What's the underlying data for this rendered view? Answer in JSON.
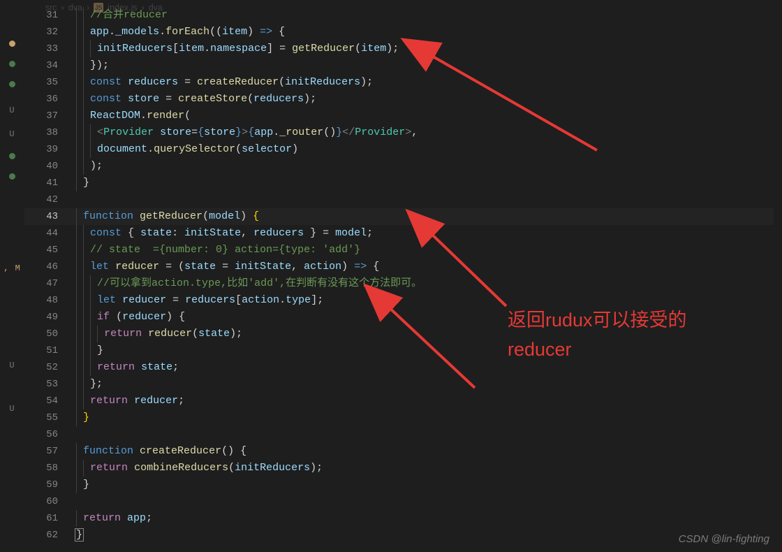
{
  "breadcrumb": {
    "seg1": "src",
    "seg2": "dva",
    "file": "index.js",
    "tail": "dva"
  },
  "rail": {
    "dots": [
      "#c9a26d",
      "#4b7a4b",
      "#4b7a4b"
    ],
    "marks": [
      "U",
      "U",
      "",
      ", M",
      "",
      "",
      "U",
      "",
      "U"
    ],
    "dots2": [
      "#4b7a4b",
      "#4b7a4b"
    ]
  },
  "lines": {
    "31": {
      "i": 2,
      "tokens": [
        [
          "c-comment",
          "//合并reducer"
        ]
      ]
    },
    "32": {
      "i": 2,
      "tokens": [
        [
          "c-var",
          "app"
        ],
        [
          "c-punct",
          "."
        ],
        [
          "c-var",
          "_models"
        ],
        [
          "c-punct",
          "."
        ],
        [
          "c-func",
          "forEach"
        ],
        [
          "c-punct",
          "(("
        ],
        [
          "c-var",
          "item"
        ],
        [
          "c-punct",
          ") "
        ],
        [
          "c-keyword",
          "=>"
        ],
        [
          "c-punct",
          " {"
        ]
      ]
    },
    "33": {
      "i": 3,
      "tokens": [
        [
          "c-var",
          "initReducers"
        ],
        [
          "c-punct",
          "["
        ],
        [
          "c-var",
          "item"
        ],
        [
          "c-punct",
          "."
        ],
        [
          "c-var",
          "namespace"
        ],
        [
          "c-punct",
          "] = "
        ],
        [
          "c-func",
          "getReducer"
        ],
        [
          "c-punct",
          "("
        ],
        [
          "c-var",
          "item"
        ],
        [
          "c-punct",
          ");"
        ]
      ]
    },
    "34": {
      "i": 2,
      "tokens": [
        [
          "c-punct",
          "});"
        ]
      ]
    },
    "35": {
      "i": 2,
      "tokens": [
        [
          "c-keyword",
          "const"
        ],
        [
          "c-punct",
          " "
        ],
        [
          "c-var",
          "reducers"
        ],
        [
          "c-punct",
          " = "
        ],
        [
          "c-func",
          "createReducer"
        ],
        [
          "c-punct",
          "("
        ],
        [
          "c-var",
          "initReducers"
        ],
        [
          "c-punct",
          ");"
        ]
      ]
    },
    "36": {
      "i": 2,
      "tokens": [
        [
          "c-keyword",
          "const"
        ],
        [
          "c-punct",
          " "
        ],
        [
          "c-var",
          "store"
        ],
        [
          "c-punct",
          " = "
        ],
        [
          "c-func",
          "createStore"
        ],
        [
          "c-punct",
          "("
        ],
        [
          "c-var",
          "reducers"
        ],
        [
          "c-punct",
          ");"
        ]
      ]
    },
    "37": {
      "i": 2,
      "tokens": [
        [
          "c-var",
          "ReactDOM"
        ],
        [
          "c-punct",
          "."
        ],
        [
          "c-func",
          "render"
        ],
        [
          "c-punct",
          "("
        ]
      ]
    },
    "38": {
      "i": 3,
      "tokens": [
        [
          "c-jsx",
          "<"
        ],
        [
          "c-type",
          "Provider"
        ],
        [
          "c-punct",
          " "
        ],
        [
          "c-var",
          "store"
        ],
        [
          "c-punct",
          "="
        ],
        [
          "c-keyword",
          "{"
        ],
        [
          "c-var",
          "store"
        ],
        [
          "c-keyword",
          "}"
        ],
        [
          "c-jsx",
          ">"
        ],
        [
          "c-keyword",
          "{"
        ],
        [
          "c-var",
          "app"
        ],
        [
          "c-punct",
          "."
        ],
        [
          "c-func",
          "_router"
        ],
        [
          "c-punct",
          "()"
        ],
        [
          "c-keyword",
          "}"
        ],
        [
          "c-jsx",
          "</"
        ],
        [
          "c-type",
          "Provider"
        ],
        [
          "c-jsx",
          ">"
        ],
        [
          "c-punct",
          ","
        ]
      ]
    },
    "39": {
      "i": 3,
      "tokens": [
        [
          "c-var",
          "document"
        ],
        [
          "c-punct",
          "."
        ],
        [
          "c-func",
          "querySelector"
        ],
        [
          "c-punct",
          "("
        ],
        [
          "c-var",
          "selector"
        ],
        [
          "c-punct",
          ")"
        ]
      ]
    },
    "40": {
      "i": 2,
      "tokens": [
        [
          "c-punct",
          ");"
        ]
      ]
    },
    "41": {
      "i": 1,
      "tokens": [
        [
          "c-punct",
          "}"
        ]
      ]
    },
    "42": {
      "i": 0,
      "tokens": []
    },
    "43": {
      "i": 1,
      "tokens": [
        [
          "c-keyword",
          "function"
        ],
        [
          "c-punct",
          " "
        ],
        [
          "c-func",
          "getReducer"
        ],
        [
          "c-punct",
          "("
        ],
        [
          "c-var",
          "model"
        ],
        [
          "c-punct",
          ") "
        ],
        [
          "bracket-y",
          "{"
        ]
      ]
    },
    "44": {
      "i": 2,
      "tokens": [
        [
          "c-keyword",
          "const"
        ],
        [
          "c-punct",
          " { "
        ],
        [
          "c-var",
          "state"
        ],
        [
          "c-punct",
          ": "
        ],
        [
          "c-var",
          "initState"
        ],
        [
          "c-punct",
          ", "
        ],
        [
          "c-var",
          "reducers"
        ],
        [
          "c-punct",
          " } = "
        ],
        [
          "c-var",
          "model"
        ],
        [
          "c-punct",
          ";"
        ]
      ]
    },
    "45": {
      "i": 2,
      "tokens": [
        [
          "c-comment",
          "// state  ={number: 0} action={type: 'add'}"
        ]
      ]
    },
    "46": {
      "i": 2,
      "tokens": [
        [
          "c-keyword",
          "let"
        ],
        [
          "c-punct",
          " "
        ],
        [
          "c-func",
          "reducer"
        ],
        [
          "c-punct",
          " = ("
        ],
        [
          "c-var",
          "state"
        ],
        [
          "c-punct",
          " = "
        ],
        [
          "c-var",
          "initState"
        ],
        [
          "c-punct",
          ", "
        ],
        [
          "c-var",
          "action"
        ],
        [
          "c-punct",
          ") "
        ],
        [
          "c-keyword",
          "=>"
        ],
        [
          "c-punct",
          " {"
        ]
      ]
    },
    "47": {
      "i": 3,
      "tokens": [
        [
          "c-comment",
          "//可以拿到action.type,比如'add',在判断有没有这个方法即可。"
        ]
      ]
    },
    "48": {
      "i": 3,
      "tokens": [
        [
          "c-keyword",
          "let"
        ],
        [
          "c-punct",
          " "
        ],
        [
          "c-var",
          "reducer"
        ],
        [
          "c-punct",
          " = "
        ],
        [
          "c-var",
          "reducers"
        ],
        [
          "c-punct",
          "["
        ],
        [
          "c-var",
          "action"
        ],
        [
          "c-punct",
          "."
        ],
        [
          "c-var",
          "type"
        ],
        [
          "c-punct",
          "];"
        ]
      ]
    },
    "49": {
      "i": 3,
      "tokens": [
        [
          "c-purple",
          "if"
        ],
        [
          "c-punct",
          " ("
        ],
        [
          "c-var",
          "reducer"
        ],
        [
          "c-punct",
          ") {"
        ]
      ]
    },
    "50": {
      "i": 4,
      "tokens": [
        [
          "c-purple",
          "return"
        ],
        [
          "c-punct",
          " "
        ],
        [
          "c-func",
          "reducer"
        ],
        [
          "c-punct",
          "("
        ],
        [
          "c-var",
          "state"
        ],
        [
          "c-punct",
          ");"
        ]
      ]
    },
    "51": {
      "i": 3,
      "tokens": [
        [
          "c-punct",
          "}"
        ]
      ]
    },
    "52": {
      "i": 3,
      "tokens": [
        [
          "c-purple",
          "return"
        ],
        [
          "c-punct",
          " "
        ],
        [
          "c-var",
          "state"
        ],
        [
          "c-punct",
          ";"
        ]
      ]
    },
    "53": {
      "i": 2,
      "tokens": [
        [
          "c-punct",
          "};"
        ]
      ]
    },
    "54": {
      "i": 2,
      "tokens": [
        [
          "c-purple",
          "return"
        ],
        [
          "c-punct",
          " "
        ],
        [
          "c-var",
          "reducer"
        ],
        [
          "c-punct",
          ";"
        ]
      ]
    },
    "55": {
      "i": 1,
      "tokens": [
        [
          "bracket-y",
          "}"
        ]
      ]
    },
    "56": {
      "i": 0,
      "tokens": []
    },
    "57": {
      "i": 1,
      "tokens": [
        [
          "c-keyword",
          "function"
        ],
        [
          "c-punct",
          " "
        ],
        [
          "c-func",
          "createReducer"
        ],
        [
          "c-punct",
          "() {"
        ]
      ]
    },
    "58": {
      "i": 2,
      "tokens": [
        [
          "c-purple",
          "return"
        ],
        [
          "c-punct",
          " "
        ],
        [
          "c-func",
          "combineReducers"
        ],
        [
          "c-punct",
          "("
        ],
        [
          "c-var",
          "initReducers"
        ],
        [
          "c-punct",
          ");"
        ]
      ]
    },
    "59": {
      "i": 1,
      "tokens": [
        [
          "c-punct",
          "}"
        ]
      ]
    },
    "60": {
      "i": 0,
      "tokens": []
    },
    "61": {
      "i": 1,
      "tokens": [
        [
          "c-purple",
          "return"
        ],
        [
          "c-punct",
          " "
        ],
        [
          "c-var",
          "app"
        ],
        [
          "c-punct",
          ";"
        ]
      ]
    },
    "62": {
      "i": 0,
      "tokens": [
        [
          "sel-bracket",
          "}"
        ]
      ]
    }
  },
  "lineOrder": [
    "31",
    "32",
    "33",
    "34",
    "35",
    "36",
    "37",
    "38",
    "39",
    "40",
    "41",
    "42",
    "43",
    "44",
    "45",
    "46",
    "47",
    "48",
    "49",
    "50",
    "51",
    "52",
    "53",
    "54",
    "55",
    "56",
    "57",
    "58",
    "59",
    "60",
    "61",
    "62"
  ],
  "currentLine": "43",
  "annotation": {
    "text1": "返回rudux可以接受的",
    "text2": "reducer"
  },
  "watermark": "CSDN @lin-fighting"
}
